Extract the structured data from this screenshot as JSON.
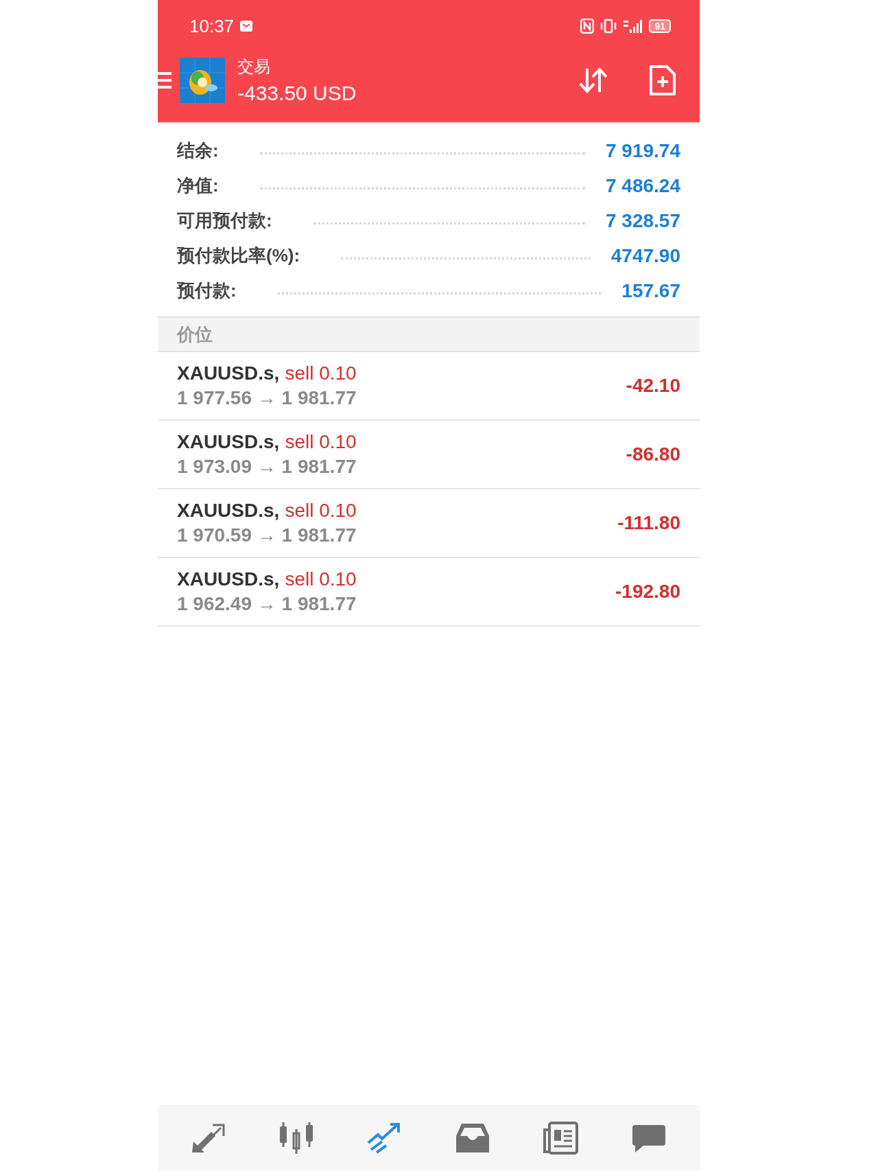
{
  "status_bar": {
    "time": "10:37",
    "battery": "91"
  },
  "header": {
    "title": "交易",
    "balance": "-433.50 USD"
  },
  "summary": [
    {
      "label": "结余:",
      "value": "7 919.74"
    },
    {
      "label": "净值:",
      "value": "7 486.24"
    },
    {
      "label": "可用预付款:",
      "value": "7 328.57"
    },
    {
      "label": "预付款比率(%):",
      "value": "4747.90"
    },
    {
      "label": "预付款:",
      "value": "157.67"
    }
  ],
  "section_title": "价位",
  "positions": [
    {
      "symbol": "XAUUSD.s,",
      "side": "sell",
      "volume": "0.10",
      "prices": "1 977.56 → 1 981.77",
      "profit": "-42.10"
    },
    {
      "symbol": "XAUUSD.s,",
      "side": "sell",
      "volume": "0.10",
      "prices": "1 973.09 → 1 981.77",
      "profit": "-86.80"
    },
    {
      "symbol": "XAUUSD.s,",
      "side": "sell",
      "volume": "0.10",
      "prices": "1 970.59 → 1 981.77",
      "profit": "-111.80"
    },
    {
      "symbol": "XAUUSD.s,",
      "side": "sell",
      "volume": "0.10",
      "prices": "1 962.49 → 1 981.77",
      "profit": "-192.80"
    }
  ],
  "bottom_nav": [
    {
      "kind": "quotes",
      "selected": false
    },
    {
      "kind": "chart",
      "selected": false
    },
    {
      "kind": "trade",
      "selected": true
    },
    {
      "kind": "history",
      "selected": false
    },
    {
      "kind": "news",
      "selected": false
    },
    {
      "kind": "messages",
      "selected": false
    }
  ]
}
